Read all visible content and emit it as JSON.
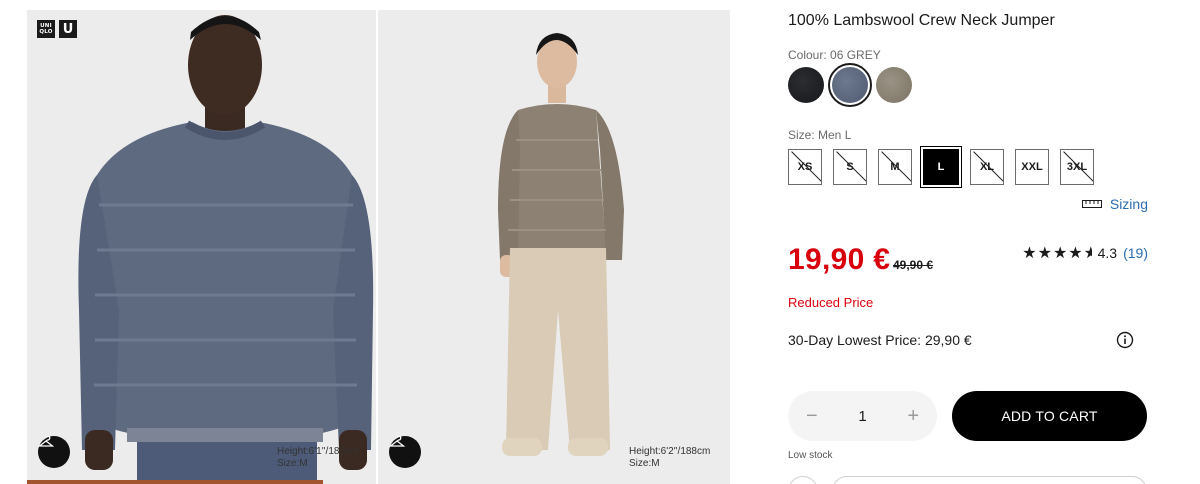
{
  "brand": {
    "logo_top": "UNI",
    "logo_bottom": "QLO",
    "logo_u": "U"
  },
  "gallery": {
    "photos": [
      {
        "model_height": "Height:6'1''/185cm",
        "model_size": "Size:M",
        "sweater_color": "#5e6a80"
      },
      {
        "model_height": "Height:6'2''/188cm",
        "model_size": "Size:M",
        "sweater_color": "#8c8172"
      }
    ]
  },
  "product": {
    "title": "100% Lambswool Crew Neck Jumper",
    "colour_label": "Colour: 06 GREY",
    "colours": [
      {
        "name": "black",
        "hex": "#1e1f22",
        "selected": false
      },
      {
        "name": "grey",
        "hex": "#5e6a80",
        "selected": true
      },
      {
        "name": "beige",
        "hex": "#8d8576",
        "selected": false
      }
    ],
    "size_label": "Size: Men L",
    "sizes": [
      {
        "label": "XS",
        "available": false,
        "selected": false
      },
      {
        "label": "S",
        "available": false,
        "selected": false
      },
      {
        "label": "M",
        "available": false,
        "selected": false
      },
      {
        "label": "L",
        "available": true,
        "selected": true
      },
      {
        "label": "XL",
        "available": false,
        "selected": false
      },
      {
        "label": "XXL",
        "available": true,
        "selected": false
      },
      {
        "label": "3XL",
        "available": false,
        "selected": false
      }
    ],
    "sizing_link": "Sizing",
    "price": "19,90 €",
    "old_price": "49,90 €",
    "rating_value": "4.3",
    "rating_count": "(19)",
    "rating_stars": 4.5,
    "reduced_label": "Reduced Price",
    "lowest_price_label": "30-Day Lowest Price: 29,90 €",
    "quantity": "1",
    "minus": "−",
    "plus": "+",
    "add_to_cart": "ADD TO CART",
    "stock_status": "Low stock"
  },
  "colors": {
    "accent_red": "#d9000d",
    "link_blue": "#2b6bb2",
    "button_black": "#000000"
  }
}
